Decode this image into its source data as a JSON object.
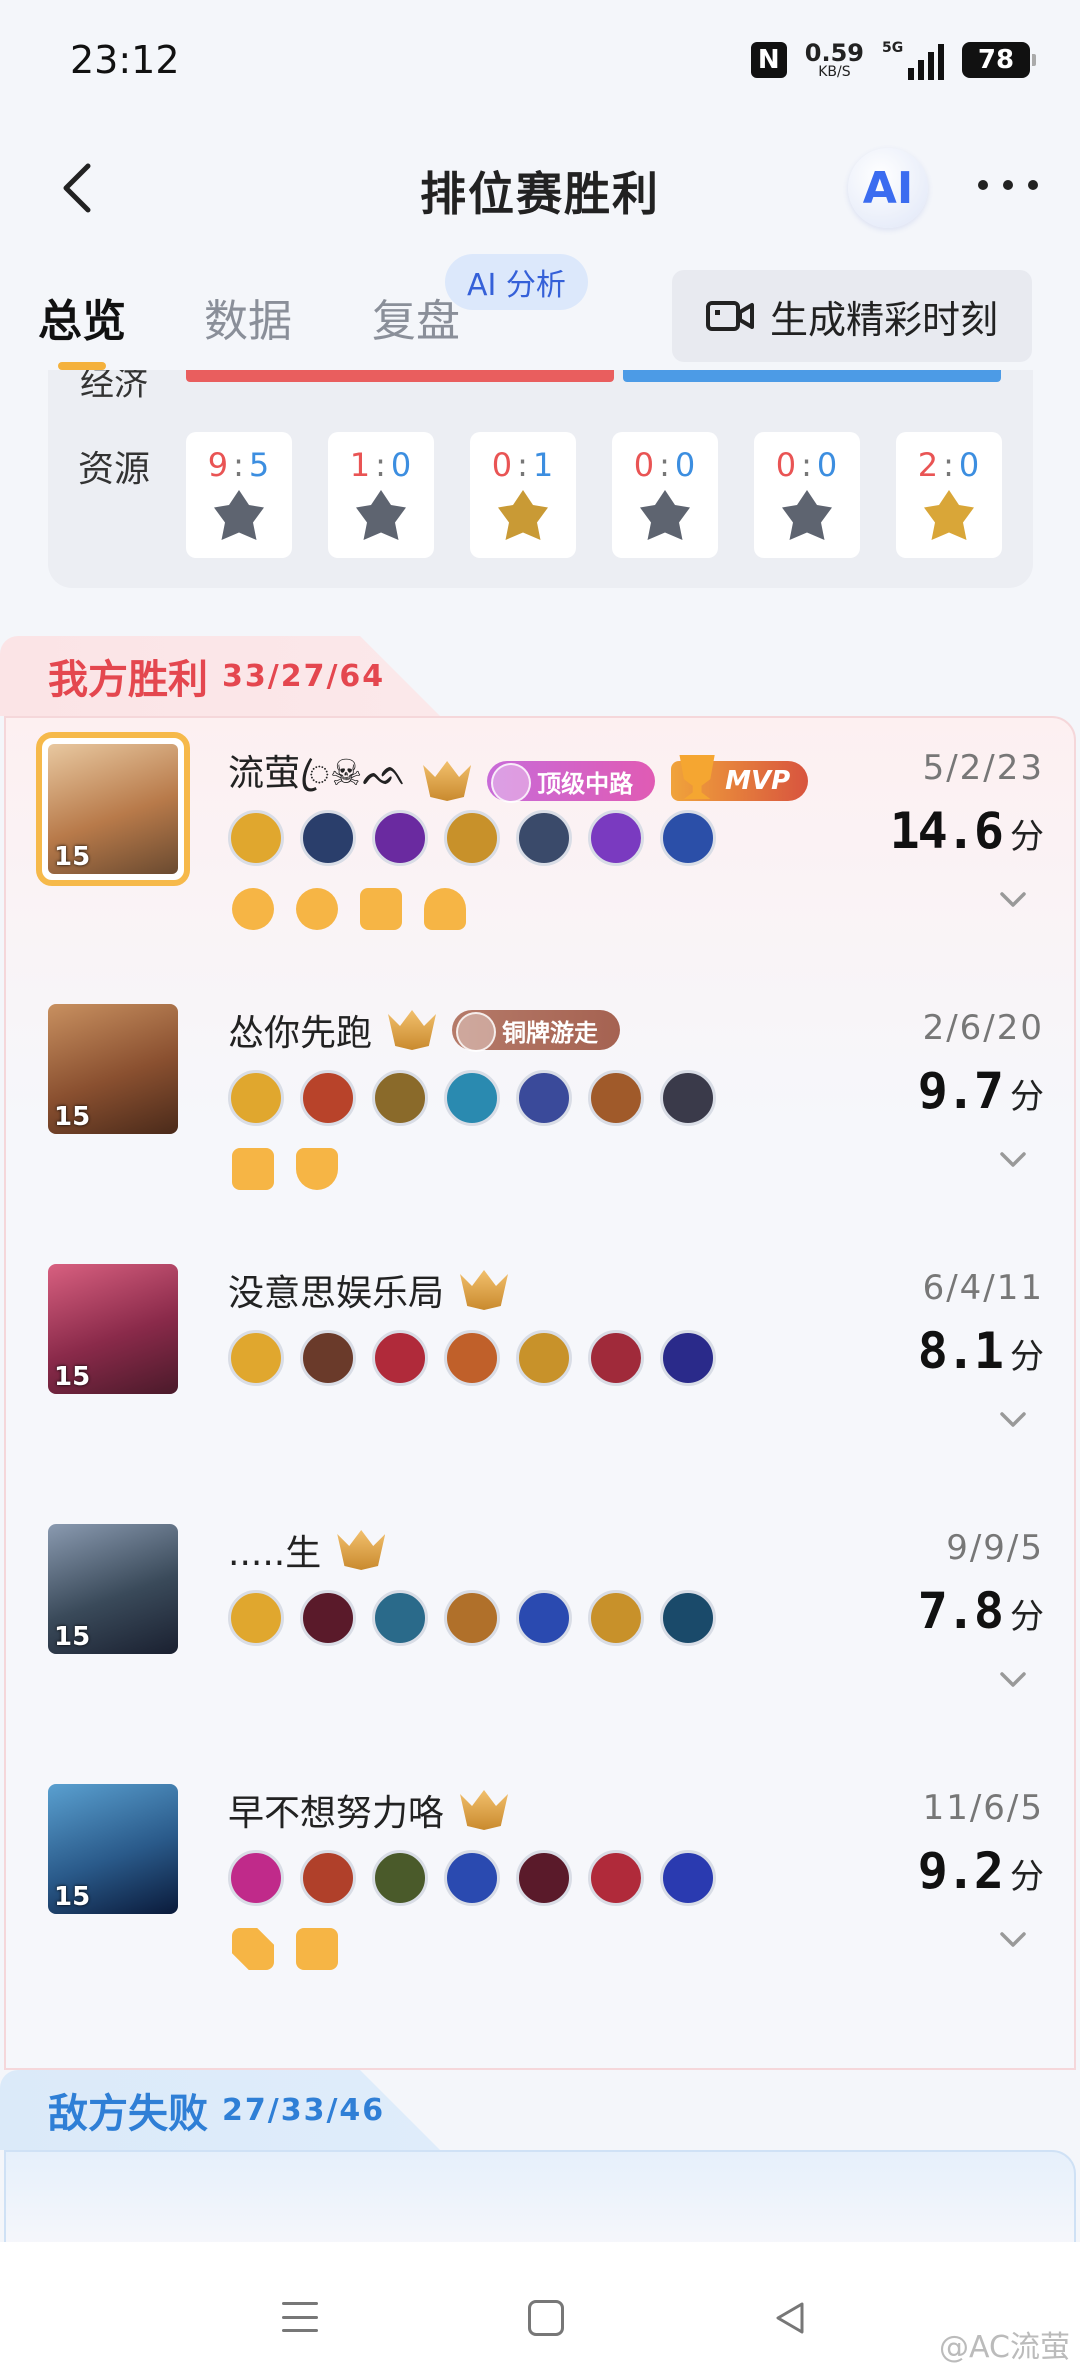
{
  "status_bar": {
    "time": "23:12",
    "nfc": "N",
    "net_speed": "0.59",
    "net_unit": "KB/S",
    "network": "5G",
    "battery": "78"
  },
  "nav": {
    "title": "排位赛胜利",
    "ai_label": "AI"
  },
  "tabs": [
    {
      "label": "总览",
      "active": true
    },
    {
      "label": "数据",
      "active": false
    },
    {
      "label": "复盘",
      "active": false
    }
  ],
  "ai_badge": "AI 分析",
  "highlight_button": "生成精彩时刻",
  "resources": {
    "economy_label": "经济",
    "label": "资源",
    "items": [
      {
        "a": "9",
        "b": "5",
        "icon": "tyrant-icon"
      },
      {
        "a": "1",
        "b": "0",
        "icon": "shadow-lord-icon"
      },
      {
        "a": "0",
        "b": "1",
        "icon": "storm-dragon-icon"
      },
      {
        "a": "0",
        "b": "0",
        "icon": "overlord-icon"
      },
      {
        "a": "0",
        "b": "0",
        "icon": "red-buff-icon"
      },
      {
        "a": "2",
        "b": "0",
        "icon": "blue-buff-icon"
      }
    ]
  },
  "ally_team": {
    "title": "我方胜利",
    "kda": "33/27/64",
    "players": [
      {
        "name": "流萤ꦿ☠︎︎ᨒ",
        "level": "15",
        "kda": "5/2/23",
        "score": "14.6",
        "unit": "分",
        "mvp": true,
        "position_badge": "顶级中路",
        "mvp_label": "MVP",
        "items": [
          "#e0a72e",
          "#2a3e6b",
          "#6a2aa0",
          "#c8912a",
          "#3a4a6a",
          "#7a3ac0",
          "#2b4fa8"
        ],
        "runes": 4
      },
      {
        "name": "怂你先跑",
        "level": "15",
        "kda": "2/6/20",
        "score": "9.7",
        "unit": "分",
        "mvp": false,
        "position_badge": "铜牌游走",
        "items": [
          "#e0a72e",
          "#b8432a",
          "#8a6a2a",
          "#2a8ab0",
          "#3a4a9a",
          "#a05a2a",
          "#3a3a4a"
        ],
        "runes": 2
      },
      {
        "name": "没意思娱乐局",
        "level": "15",
        "kda": "6/4/11",
        "score": "8.1",
        "unit": "分",
        "mvp": false,
        "position_badge": "",
        "items": [
          "#e0a72e",
          "#6a3a2a",
          "#b02a3a",
          "#c0602a",
          "#c8922a",
          "#a02a3a",
          "#2a2a8a"
        ],
        "runes": 0
      },
      {
        "name": ".....生",
        "level": "15",
        "kda": "9/9/5",
        "score": "7.8",
        "unit": "分",
        "mvp": false,
        "position_badge": "",
        "items": [
          "#e0a72e",
          "#5a1a2a",
          "#2a6a8a",
          "#b0702a",
          "#2a4ab0",
          "#c8912a",
          "#1a4a6a"
        ],
        "runes": 0
      },
      {
        "name": "早不想努力咯",
        "level": "15",
        "kda": "11/6/5",
        "score": "9.2",
        "unit": "分",
        "mvp": false,
        "position_badge": "",
        "items": [
          "#c02a8a",
          "#b0402a",
          "#4a5a2a",
          "#2a4ab0",
          "#5a1a2a",
          "#b02a3a",
          "#2a3ab0"
        ],
        "runes": 2
      }
    ]
  },
  "enemy_team": {
    "title": "敌方失败",
    "kda": "27/33/46"
  },
  "watermark": "@AC流萤",
  "colors": {
    "win_red": "#e4474f",
    "lose_blue": "#2f7fd6",
    "gold": "#f6b94a"
  }
}
